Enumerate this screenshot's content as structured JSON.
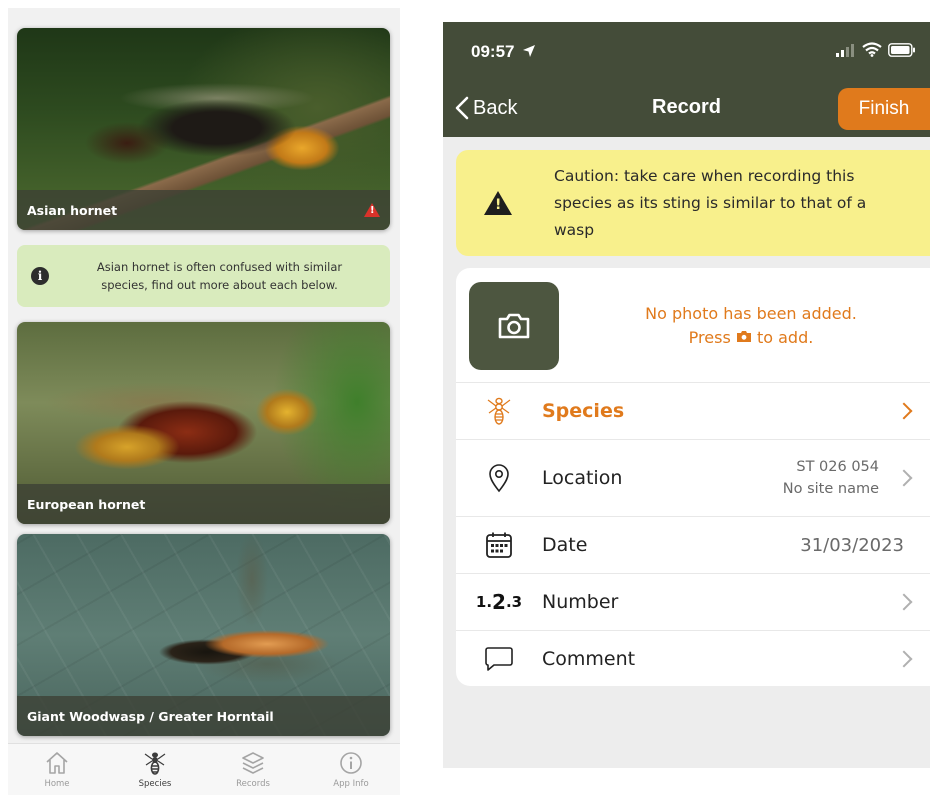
{
  "species_list": {
    "cards": [
      {
        "name": "Asian hornet",
        "warning": true
      },
      {
        "name": "European hornet",
        "warning": false
      },
      {
        "name": "Giant Woodwasp / Greater Horntail",
        "warning": false
      }
    ],
    "info_banner": "Asian hornet is often confused with similar species, find out more about each below.",
    "tabs": [
      {
        "label": "Home",
        "icon": "home-icon"
      },
      {
        "label": "Species",
        "icon": "wasp-icon",
        "active": true
      },
      {
        "label": "Records",
        "icon": "layers-icon"
      },
      {
        "label": "App Info",
        "icon": "info-icon"
      }
    ]
  },
  "record": {
    "status_time": "09:57",
    "back_label": "Back",
    "title": "Record",
    "finish_label": "Finish",
    "caution_text": "Caution: take care when recording this species as its sting is similar to that of a wasp",
    "photo_msg_line1": "No photo has been added.",
    "photo_msg_pre": "Press",
    "photo_msg_post": "to add.",
    "rows": {
      "species": "Species",
      "location": "Location",
      "location_grid": "ST 026 054",
      "location_site": "No site name",
      "date": "Date",
      "date_value": "31/03/2023",
      "number": "Number",
      "comment": "Comment"
    },
    "colors": {
      "header": "#444c39",
      "accent": "#e07a1c",
      "caution": "#f8f08c"
    }
  }
}
